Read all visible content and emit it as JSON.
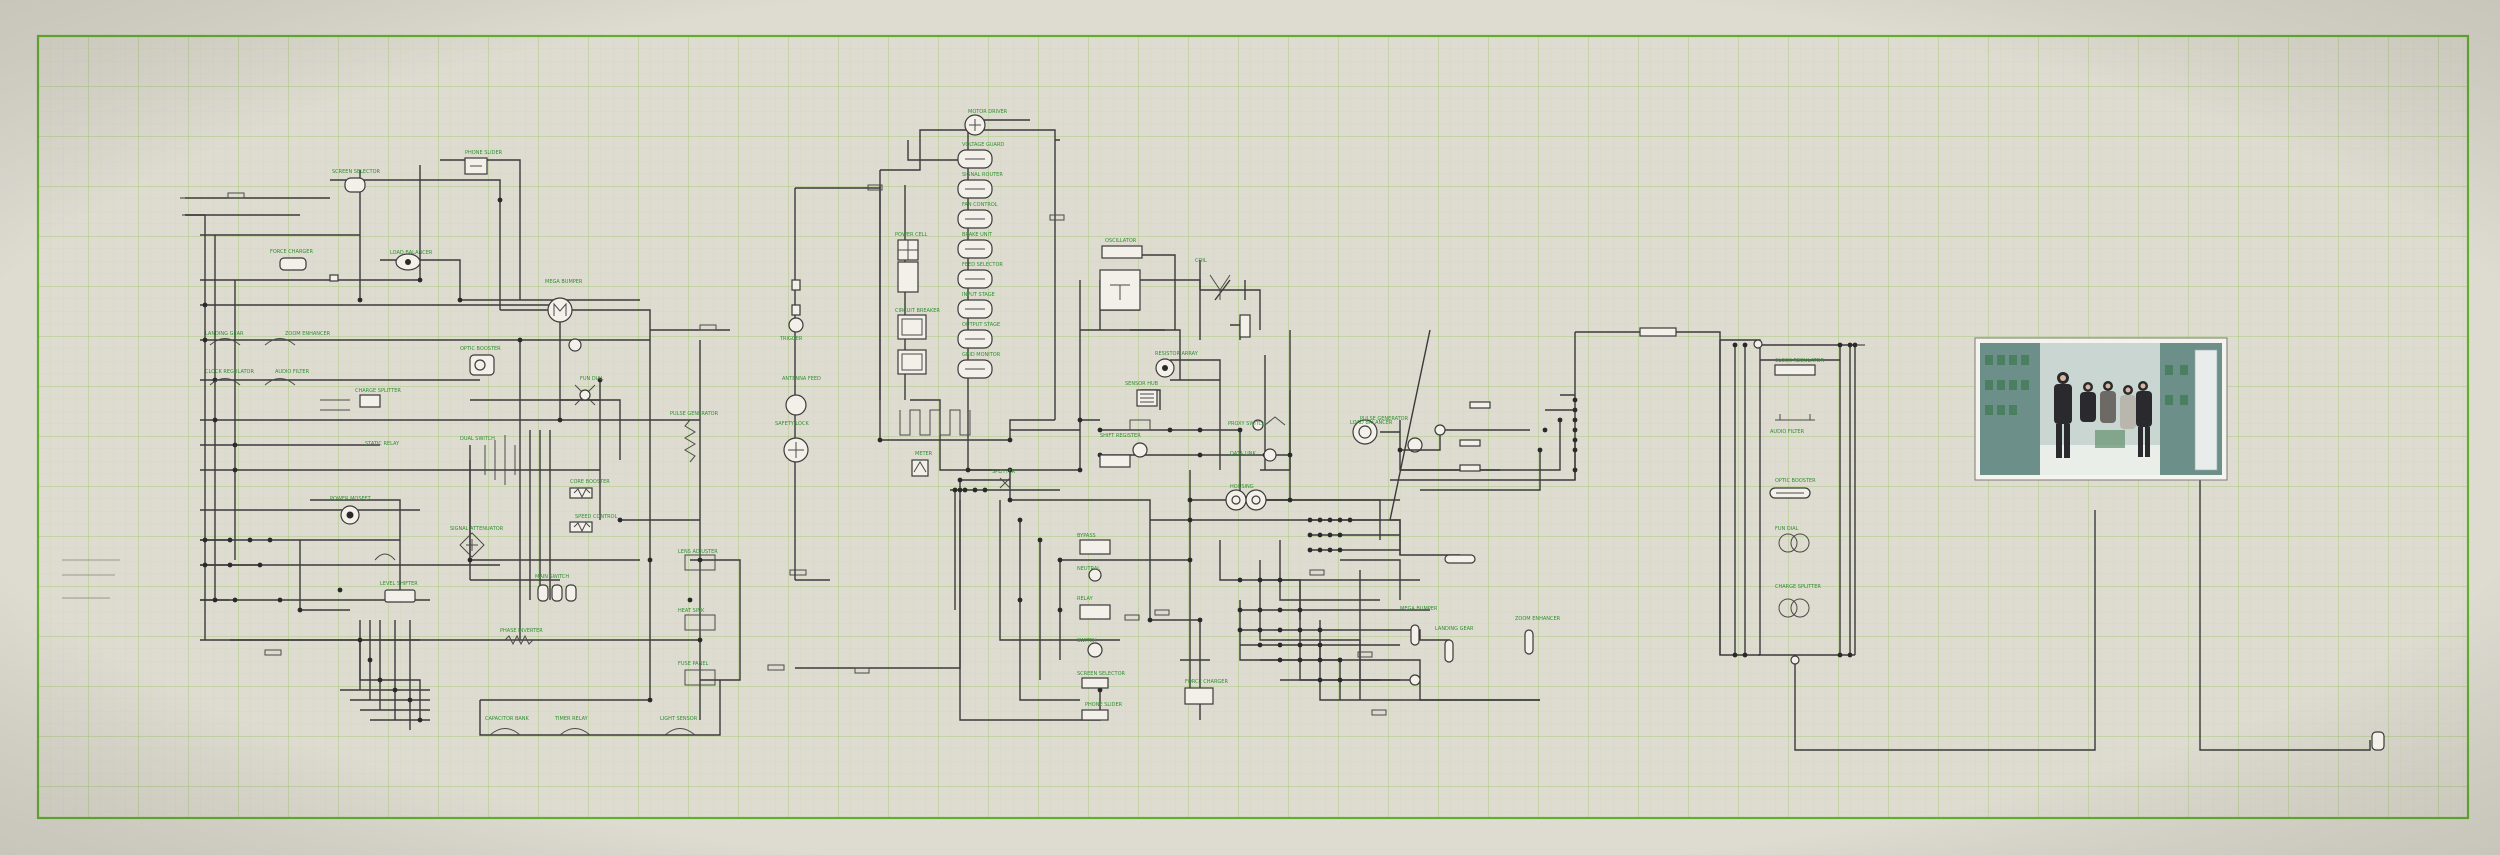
{
  "colors": {
    "paper": "#dedcd1",
    "grid_minor": "#c9d3a8",
    "grid_major": "#8cbf5a",
    "border": "#5aa62b",
    "wire": "#3a3a3a",
    "label": "#2e8f2e"
  },
  "labels": [
    "SCREEN SELECTOR",
    "PHONE SLIDER",
    "FORCE CHARGER",
    "LOAD BALANCER",
    "MEGA BUMPER",
    "LANDING GEAR",
    "ZOOM ENHANCER",
    "CLOCK REGULATOR",
    "AUDIO FILTER",
    "OPTIC BOOSTER",
    "FUN DIAL",
    "CHARGE SPLITTER",
    "PULSE GENERATOR",
    "DUAL SWITCH",
    "STATIC RELAY",
    "CORE BOOSTER",
    "SPEED CONTROL",
    "SIGNAL ATTENUATOR",
    "POWER MOSFET",
    "MAIN SWITCH",
    "LEVEL SHIFTER",
    "PHASE INVERTER",
    "LENS ADJUSTER",
    "HEAT SINK",
    "FUSE PANEL",
    "CAPACITOR BANK",
    "TIMER RELAY",
    "LIGHT SENSOR",
    "MOTOR DRIVER",
    "VOLTAGE GUARD",
    "SIGNAL ROUTER",
    "FAN CONTROL",
    "BRAKE UNIT",
    "FEED SELECTOR",
    "INPUT STAGE",
    "OUTPUT STAGE",
    "GRID MONITOR",
    "POWER CELL",
    "CIRCUIT BREAKER",
    "TRIGGER",
    "ANTENNA FEED",
    "SAFETY LOCK",
    "METER",
    "SPLITTER",
    "OSCILLATOR",
    "COIL",
    "RESISTOR ARRAY",
    "SENSOR HUB",
    "SHIFT REGISTER",
    "PROXY SWITCH",
    "DATA LINK",
    "HOUSING",
    "BYPASS",
    "NEUTRAL",
    "RELAY",
    "SWITCH"
  ],
  "photo": {
    "description_name": "team-photo"
  }
}
